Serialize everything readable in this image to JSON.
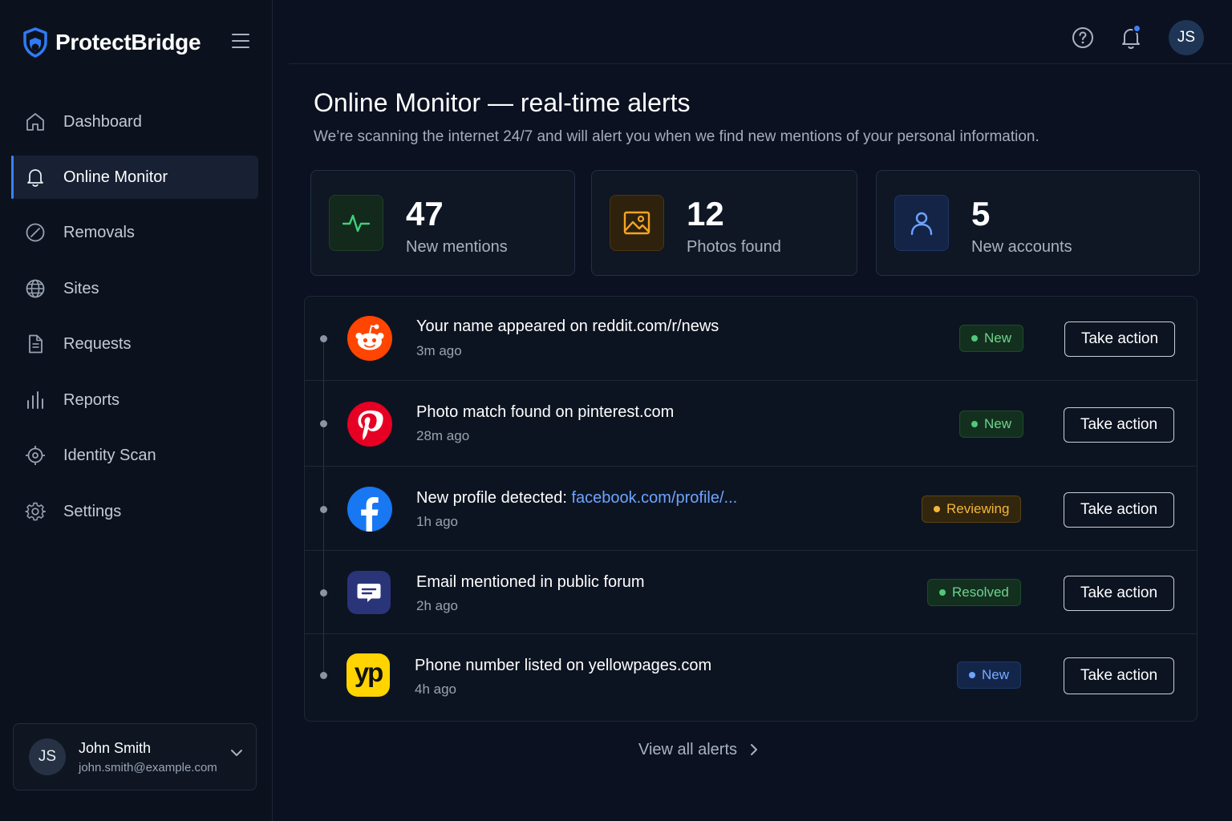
{
  "app": {
    "brand_name": "ProtectBridge",
    "accent_color": "#3b82f6"
  },
  "sidebar": {
    "items": [
      {
        "label": "Dashboard",
        "icon": "home-icon",
        "active": false
      },
      {
        "label": "Online Monitor",
        "icon": "bell-icon",
        "active": true
      },
      {
        "label": "Removals",
        "icon": "slash-circle-icon",
        "active": false
      },
      {
        "label": "Sites",
        "icon": "globe-icon",
        "active": false
      },
      {
        "label": "Requests",
        "icon": "document-icon",
        "active": false
      },
      {
        "label": "Reports",
        "icon": "bar-chart-icon",
        "active": false
      },
      {
        "label": "Identity Scan",
        "icon": "crosshair-icon",
        "active": false
      },
      {
        "label": "Settings",
        "icon": "gear-icon",
        "active": false
      }
    ],
    "user": {
      "initials": "JS",
      "name": "John Smith",
      "email": "john.smith@example.com"
    }
  },
  "topbar": {
    "avatar_initials": "JS",
    "icons": [
      "help-icon",
      "notification-bell-icon"
    ]
  },
  "main": {
    "title": "Online Monitor — real-time alerts",
    "subtitle": "We’re scanning the internet 24/7 and will alert you when we find new mentions of your personal information.",
    "stats": [
      {
        "value": "47",
        "label": "New mentions",
        "icon": "activity-icon",
        "color": "#3fd07a"
      },
      {
        "value": "12",
        "label": "Photos found",
        "icon": "image-icon",
        "color": "#f4a425"
      },
      {
        "value": "5",
        "label": "New accounts",
        "icon": "user-icon",
        "color": "#6ea3ff"
      }
    ],
    "alerts": [
      {
        "title": "Your name appeared on reddit.com/r/news",
        "link": "",
        "time": "3m ago",
        "status": "New",
        "status_color": "green",
        "source_icon": "reddit-icon",
        "action": "Take action"
      },
      {
        "title": "Photo match found on pinterest.com",
        "link": "",
        "time": "28m ago",
        "status": "New",
        "status_color": "green",
        "source_icon": "pinterest-icon",
        "action": "Take action"
      },
      {
        "title": "New profile detected: ",
        "link": "facebook.com/profile/...",
        "time": "1h ago",
        "status": "Reviewing",
        "status_color": "amber",
        "source_icon": "facebook-icon",
        "action": "Take action"
      },
      {
        "title": "Email mentioned in public forum",
        "link": "",
        "time": "2h ago",
        "status": "Resolved",
        "status_color": "green",
        "source_icon": "forum-chat-icon",
        "action": "Take action"
      },
      {
        "title": "Phone number listed on yellowpages.com",
        "link": "",
        "time": "4h ago",
        "status": "New",
        "status_color": "blue",
        "source_icon": "yellowpages-icon",
        "action": "Take action",
        "logo_text": "yp"
      }
    ],
    "view_all_label": "View all alerts"
  }
}
